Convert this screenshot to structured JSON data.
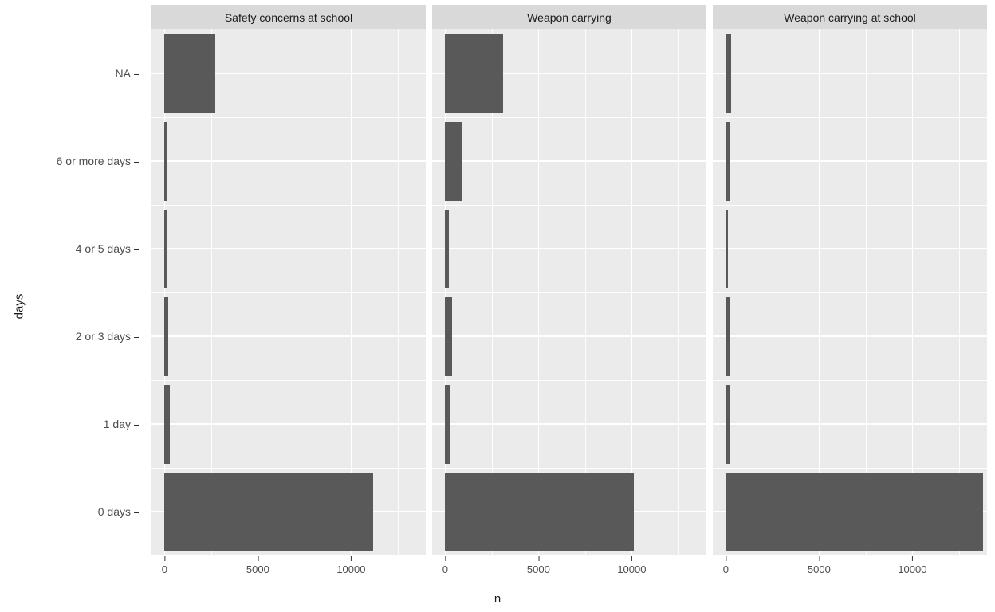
{
  "axis": {
    "x_title": "n",
    "y_title": "days"
  },
  "chart_data": [
    {
      "type": "bar",
      "title": "Safety concerns at school",
      "orientation": "horizontal",
      "xlabel": "n",
      "ylabel": "days",
      "xlim": [
        -700,
        14000
      ],
      "x_ticks": [
        0,
        5000,
        10000
      ],
      "categories": [
        "0 days",
        "1 day",
        "2 or 3 days",
        "4 or 5 days",
        "6 or more days",
        "NA"
      ],
      "values": [
        11200,
        300,
        200,
        100,
        150,
        2700
      ]
    },
    {
      "type": "bar",
      "title": "Weapon carrying",
      "orientation": "horizontal",
      "xlabel": "n",
      "ylabel": "days",
      "xlim": [
        -700,
        14000
      ],
      "x_ticks": [
        0,
        5000,
        10000
      ],
      "categories": [
        "0 days",
        "1 day",
        "2 or 3 days",
        "4 or 5 days",
        "6 or more days",
        "NA"
      ],
      "values": [
        10100,
        300,
        350,
        180,
        900,
        3100
      ]
    },
    {
      "type": "bar",
      "title": "Weapon carrying at school",
      "orientation": "horizontal",
      "xlabel": "n",
      "ylabel": "days",
      "xlim": [
        -700,
        14000
      ],
      "x_ticks": [
        0,
        5000,
        10000
      ],
      "categories": [
        "0 days",
        "1 day",
        "2 or 3 days",
        "4 or 5 days",
        "6 or more days",
        "NA"
      ],
      "values": [
        13800,
        200,
        180,
        120,
        250,
        300
      ]
    }
  ],
  "style": {
    "bar_fill": "#595959",
    "panel_bg": "#ebebeb",
    "strip_bg": "#d9d9d9"
  }
}
